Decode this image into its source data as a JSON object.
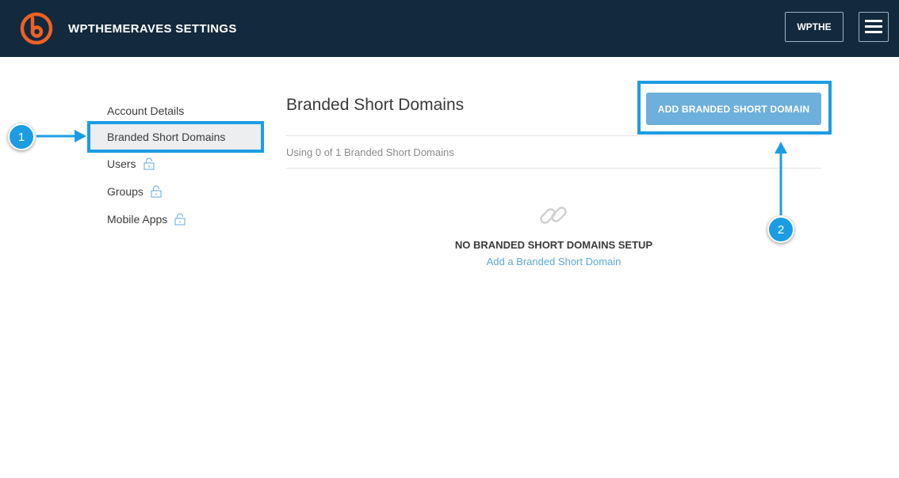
{
  "header": {
    "app_title": "WPTHEMERAVES SETTINGS",
    "account_label": "WPTHE",
    "logo_icon": "bitly-logo-icon",
    "menu_icon": "hamburger-menu-icon",
    "brand_color": "#ee6123",
    "bar_color": "#13293d"
  },
  "sidebar": {
    "items": [
      {
        "label": "Account Details",
        "locked": false,
        "active": false
      },
      {
        "label": "Branded Short Domains",
        "locked": false,
        "active": true
      },
      {
        "label": "Users",
        "locked": true,
        "active": false
      },
      {
        "label": "Groups",
        "locked": true,
        "active": false
      },
      {
        "label": "Mobile Apps",
        "locked": true,
        "active": false
      }
    ],
    "lock_icon": "lock-icon"
  },
  "main": {
    "title": "Branded Short Domains",
    "add_button_label": "ADD BRANDED SHORT DOMAIN",
    "usage_text": "Using 0 of 1 Branded Short Domains",
    "empty_state": {
      "icon": "link-icon",
      "title": "NO BRANDED SHORT DOMAINS SETUP",
      "link_label": "Add a Branded Short Domain"
    }
  },
  "annotations": {
    "color": "#1c9de3",
    "steps": [
      {
        "number": "1",
        "target": "Branded Short Domains"
      },
      {
        "number": "2",
        "target": "ADD BRANDED SHORT DOMAIN"
      }
    ]
  }
}
